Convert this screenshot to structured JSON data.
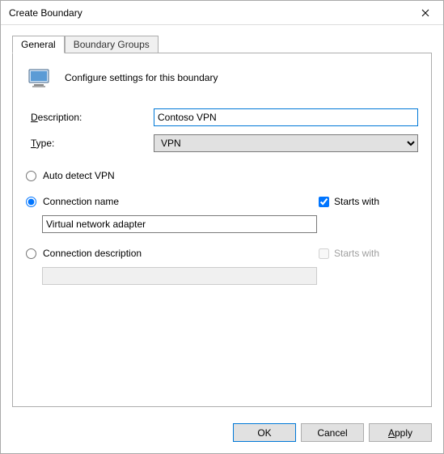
{
  "window": {
    "title": "Create Boundary"
  },
  "tabs": {
    "general": "General",
    "groups": "Boundary Groups"
  },
  "header": {
    "text": "Configure settings for this boundary"
  },
  "fields": {
    "description_label_pre": "",
    "description_accel": "D",
    "description_label_post": "escription:",
    "description_value": "Contoso VPN",
    "type_label_pre": "",
    "type_accel": "T",
    "type_label_post": "ype:",
    "type_value": "VPN"
  },
  "options": {
    "auto_detect": "Auto detect VPN",
    "connection_name": "Connection name",
    "connection_name_value": "Virtual network adapter",
    "connection_name_starts": "Starts with",
    "connection_desc": "Connection description",
    "connection_desc_value": "",
    "connection_desc_starts": "Starts with"
  },
  "buttons": {
    "ok": "OK",
    "cancel": "Cancel",
    "apply_accel": "A",
    "apply_post": "pply"
  }
}
